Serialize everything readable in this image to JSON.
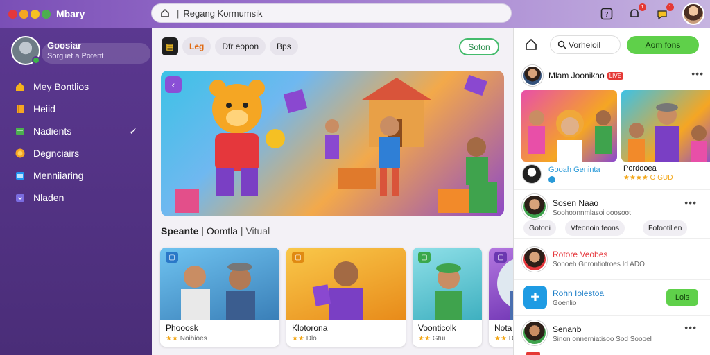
{
  "window": {
    "title": "Mbary",
    "dot_colors": [
      "#e5373c",
      "#f5a623",
      "#f5c023",
      "#4caf50"
    ]
  },
  "search": {
    "value": "Regang Kormumsik",
    "placeholder": "Regang Kormumsik"
  },
  "top_actions": {
    "icons": [
      "help-icon",
      "notification-icon",
      "messages-icon"
    ],
    "badge_counts": [
      "1",
      "1"
    ]
  },
  "sidebar": {
    "profile": {
      "name": "Goosiar",
      "subtitle": "Sorgliet a Potent"
    },
    "items": [
      {
        "label": "Mey Bontlios",
        "icon": "home-icon",
        "color": "#f5b21b"
      },
      {
        "label": "Heiid",
        "icon": "book-icon",
        "color": "#f5a623"
      },
      {
        "label": "Nadients",
        "icon": "groups-icon",
        "color": "#4caf50",
        "checked": true
      },
      {
        "label": "Degnciairs",
        "icon": "coin-icon",
        "color": "#f5a623"
      },
      {
        "label": "Menniiaring",
        "icon": "calendar-icon",
        "color": "#2196f3"
      },
      {
        "label": "Nladen",
        "icon": "inbox-icon",
        "color": "#7a6ce0"
      }
    ]
  },
  "main": {
    "chips": [
      {
        "label": "Leg",
        "style": "orange"
      },
      {
        "label": "Dfr eopon",
        "style": "plain"
      },
      {
        "label": "Bps",
        "style": "plain"
      }
    ],
    "join_button": "Soton",
    "section": {
      "title": "Speante",
      "sub1": "Oomtla",
      "sub2": "Vitual"
    },
    "cards": [
      {
        "title": "Phooosk",
        "stars": "★★",
        "meta": "Noihioes",
        "tag_color": "#2a78c8",
        "bg": "#4aa2d8"
      },
      {
        "title": "Klotorona",
        "stars": "★★",
        "meta": "Dlo",
        "tag_color": "#e08a12",
        "bg": "#f6b53a"
      },
      {
        "title": "Voonticolk",
        "stars": "★★",
        "meta": "Gtuı",
        "tag_color": "#3aa84c",
        "bg": "#5cc9d6"
      },
      {
        "title": "Nota Komunitas",
        "stars": "★★",
        "meta": "Dfos",
        "tag_color": "#6a38b0",
        "bg": "#8a4ec0"
      }
    ]
  },
  "right_panel": {
    "search_label": "Vorheioil",
    "action_button": "Aom fons",
    "post": {
      "name": "Mlam Joonikao",
      "tag": "LIVE",
      "caption_name": "Gooah Geninta",
      "caption_right": "Pordooea",
      "caption_meta": "★★★★ O GUD"
    },
    "feed": [
      {
        "title": "Sosen Naao",
        "sub": "Soohoonnmlasoi ooosoot",
        "pill1": "Gotoni",
        "pill2": "Vfeonoin feons",
        "pill3": "Fofootilien"
      },
      {
        "title": "Rotore Veobes",
        "sub": "Sonoeh Gnrontiotroes Id ADO"
      },
      {
        "title": "Rohn Iolestoa",
        "sub": "Goenlio",
        "button": "Lois"
      },
      {
        "title": "Senanb",
        "sub": "Sinon onnerniatisoo Sod Soooel"
      }
    ]
  }
}
